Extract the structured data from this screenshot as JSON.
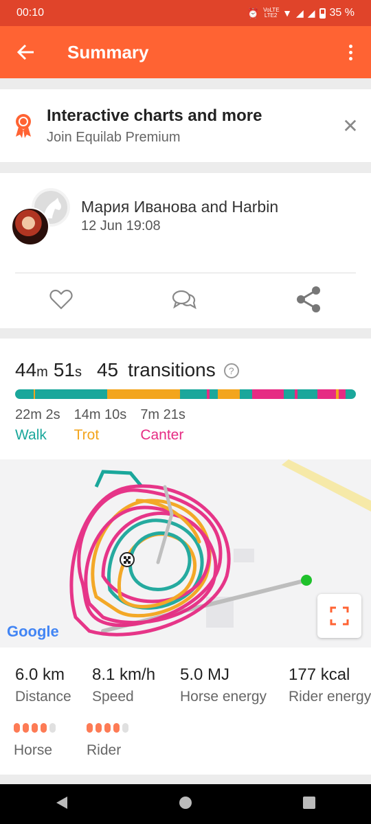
{
  "status": {
    "time": "00:10",
    "network": "VoLTE LTE2",
    "battery": "35 %"
  },
  "appbar": {
    "title": "Summary"
  },
  "promo": {
    "title": "Interactive charts and more",
    "subtitle": "Join Equilab Premium"
  },
  "session": {
    "names": "Мария Иванова and Harbin",
    "date": "12 Jun 19:08"
  },
  "summary": {
    "minutes": "44",
    "minutes_unit": "m",
    "seconds": "51",
    "seconds_unit": "s",
    "transitions_count": "45",
    "transitions_label": "transitions",
    "help": "?"
  },
  "gaits": [
    {
      "time": "22m 2s",
      "label": "Walk",
      "color": "#1aa79b"
    },
    {
      "time": "14m 10s",
      "label": "Trot",
      "color": "#f3a51d"
    },
    {
      "time": "7m 21s",
      "label": "Canter",
      "color": "#e62b83"
    }
  ],
  "map": {
    "provider": "Google"
  },
  "metrics": [
    {
      "value": "6.0 km",
      "label": "Distance"
    },
    {
      "value": "8.1 km/h",
      "label": "Speed"
    },
    {
      "value": "5.0 MJ",
      "label": "Horse energy"
    },
    {
      "value": "177 kcal",
      "label": "Rider energy"
    }
  ],
  "effort": [
    {
      "label": "Horse",
      "level": 4,
      "max": 5
    },
    {
      "label": "Rider",
      "level": 4,
      "max": 5
    }
  ],
  "colors": {
    "accent": "#ff6333",
    "status_bar": "#e0442a",
    "walk": "#1aa79b",
    "trot": "#f3a51d",
    "canter": "#e62b83"
  }
}
